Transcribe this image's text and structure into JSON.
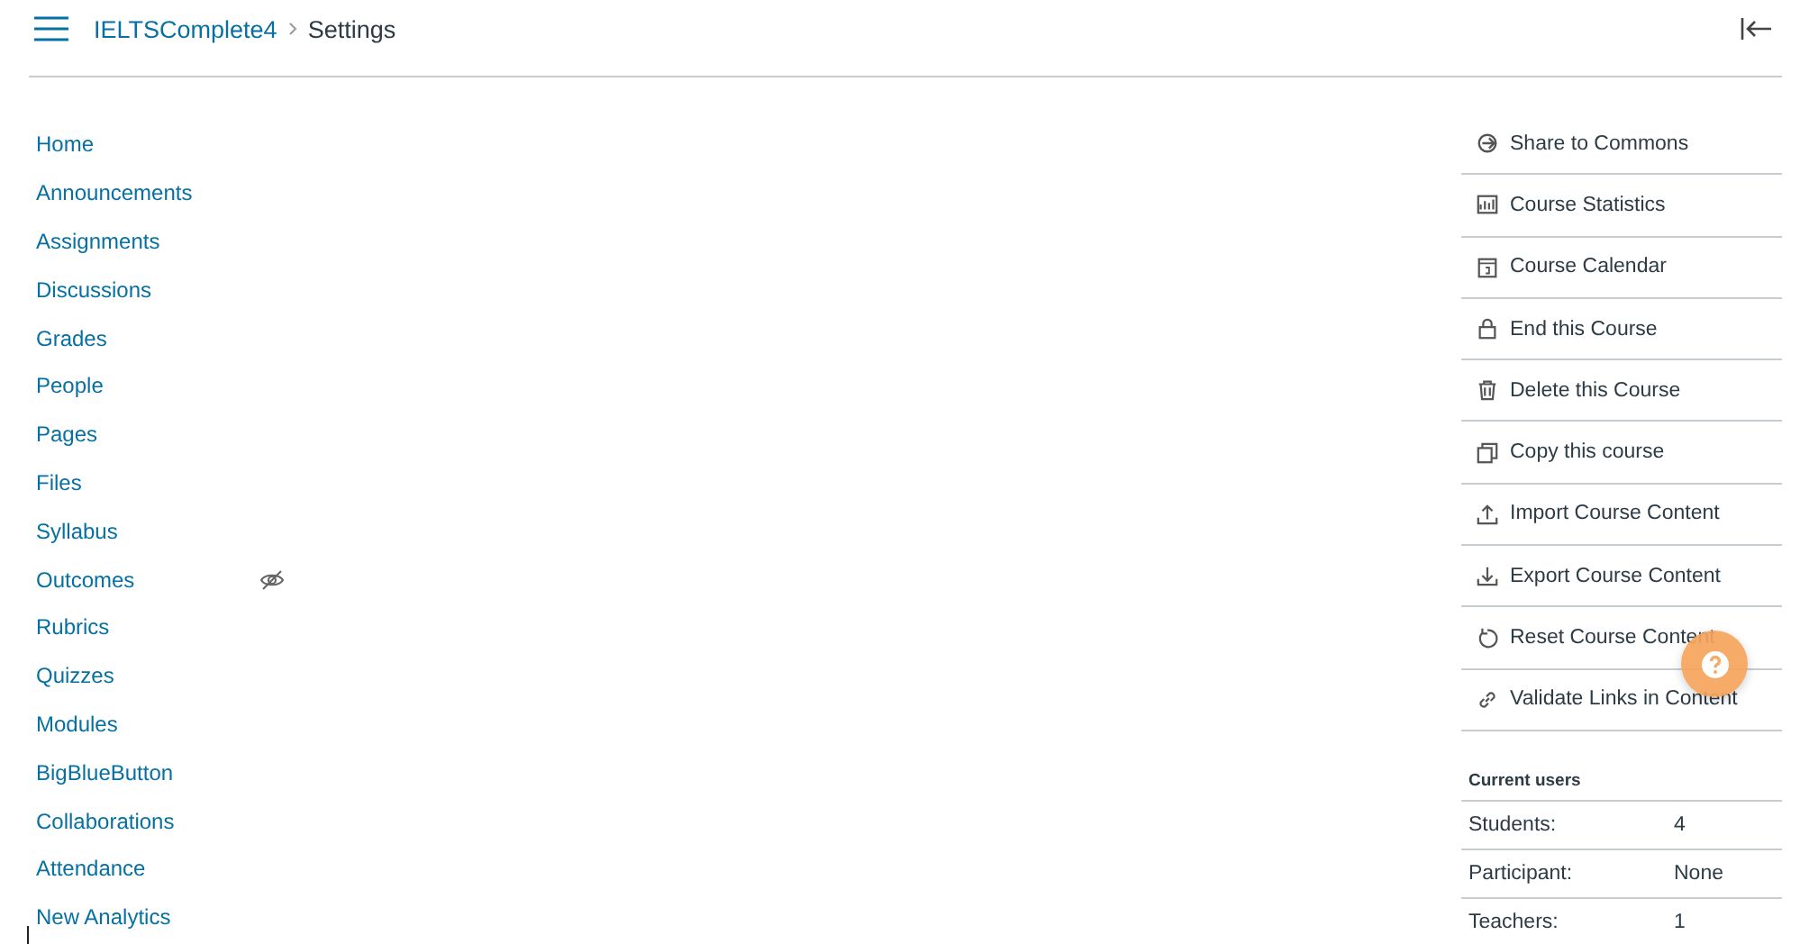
{
  "breadcrumb": {
    "course": "IELTSComplete4",
    "page": "Settings"
  },
  "nav": [
    {
      "label": "Home",
      "hidden": false
    },
    {
      "label": "Announcements",
      "hidden": false
    },
    {
      "label": "Assignments",
      "hidden": false
    },
    {
      "label": "Discussions",
      "hidden": false
    },
    {
      "label": "Grades",
      "hidden": false
    },
    {
      "label": "People",
      "hidden": false
    },
    {
      "label": "Pages",
      "hidden": false
    },
    {
      "label": "Files",
      "hidden": false
    },
    {
      "label": "Syllabus",
      "hidden": false
    },
    {
      "label": "Outcomes",
      "hidden": true
    },
    {
      "label": "Rubrics",
      "hidden": false
    },
    {
      "label": "Quizzes",
      "hidden": false
    },
    {
      "label": "Modules",
      "hidden": false
    },
    {
      "label": "BigBlueButton",
      "hidden": false
    },
    {
      "label": "Collaborations",
      "hidden": false
    },
    {
      "label": "Attendance",
      "hidden": false
    },
    {
      "label": "New Analytics",
      "hidden": false
    }
  ],
  "actions": [
    {
      "kind": "share",
      "label": "Share to Commons"
    },
    {
      "kind": "stats",
      "label": "Course Statistics"
    },
    {
      "kind": "calendar",
      "label": "Course Calendar"
    },
    {
      "kind": "lock",
      "label": "End this Course"
    },
    {
      "kind": "trash",
      "label": "Delete this Course"
    },
    {
      "kind": "copy",
      "label": "Copy this course"
    },
    {
      "kind": "upload",
      "label": "Import Course Content"
    },
    {
      "kind": "download",
      "label": "Export Course Content"
    },
    {
      "kind": "reset",
      "label": "Reset Course Content"
    },
    {
      "kind": "link",
      "label": "Validate Links in Content"
    }
  ],
  "current_users": {
    "title": "Current users",
    "rows": [
      {
        "role": "Students:",
        "count": "4"
      },
      {
        "role": "Participant:",
        "count": "None"
      },
      {
        "role": "Teachers:",
        "count": "1"
      }
    ]
  }
}
